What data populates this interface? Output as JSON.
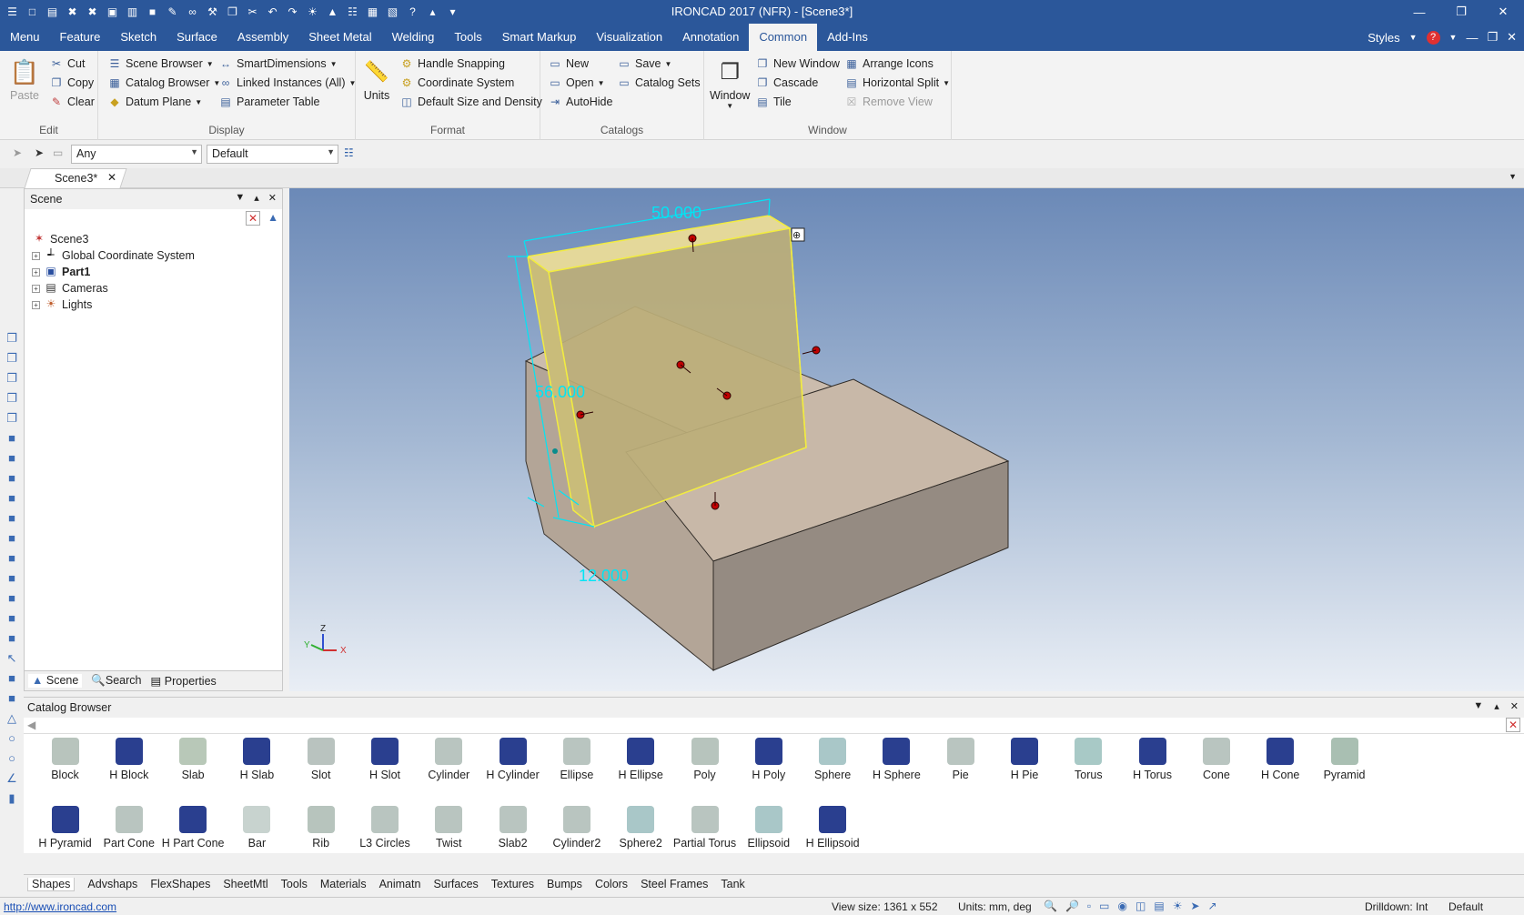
{
  "window": {
    "title": "IRONCAD 2017 (NFR) - [Scene3*]"
  },
  "qat_icons": [
    "app-menu-icon",
    "new-icon",
    "open-icon",
    "close-icon",
    "close-all-icon",
    "print-preview-icon",
    "open-folder-icon",
    "save-icon",
    "edit-icon",
    "link-icon",
    "tool-icon",
    "copy-icon",
    "cut-icon",
    "undo-icon",
    "redo-icon",
    "lightbulb-icon",
    "smart-icon",
    "list-icon",
    "table-icon",
    "layout-icon",
    "help-icon",
    "graduation-icon",
    "more-icon"
  ],
  "ribbon_tabs": [
    {
      "label": "Menu"
    },
    {
      "label": "Feature"
    },
    {
      "label": "Sketch"
    },
    {
      "label": "Surface"
    },
    {
      "label": "Assembly"
    },
    {
      "label": "Sheet Metal"
    },
    {
      "label": "Welding"
    },
    {
      "label": "Tools"
    },
    {
      "label": "Smart Markup"
    },
    {
      "label": "Visualization"
    },
    {
      "label": "Annotation"
    },
    {
      "label": "Common",
      "active": true
    },
    {
      "label": "Add-Ins"
    }
  ],
  "styles_label": "Styles",
  "ribbon": {
    "edit": {
      "label": "Edit",
      "paste": "Paste",
      "cut": "Cut",
      "copy": "Copy",
      "clear": "Clear"
    },
    "display": {
      "label": "Display",
      "scene_browser": "Scene Browser",
      "catalog_browser": "Catalog Browser",
      "datum_plane": "Datum Plane",
      "smart_dimensions": "SmartDimensions",
      "linked_instances": "Linked Instances (All)",
      "parameter_table": "Parameter Table"
    },
    "format": {
      "label": "Format",
      "units": "Units",
      "handle_snapping": "Handle Snapping",
      "coordinate_system": "Coordinate System",
      "default_size": "Default Size and Density"
    },
    "catalogs": {
      "label": "Catalogs",
      "new": "New",
      "open": "Open",
      "autohide": "AutoHide",
      "save": "Save",
      "catalog_sets": "Catalog Sets"
    },
    "window": {
      "label": "Window",
      "window": "Window",
      "new_window": "New Window",
      "cascade": "Cascade",
      "tile": "Tile",
      "arrange_icons": "Arrange Icons",
      "horizontal_split": "Horizontal Split",
      "remove_view": "Remove View"
    }
  },
  "selection": {
    "filter": "Any",
    "style": "Default"
  },
  "doc_tab": "Scene3*",
  "scene_panel": {
    "title": "Scene",
    "tree": [
      {
        "label": "Scene3",
        "icon": "scene-icon",
        "bold": false
      },
      {
        "label": "Global Coordinate System",
        "icon": "coordinate-icon",
        "bold": false
      },
      {
        "label": "Part1",
        "icon": "part-icon",
        "bold": true
      },
      {
        "label": "Cameras",
        "icon": "camera-icon",
        "bold": false
      },
      {
        "label": "Lights",
        "icon": "light-icon",
        "bold": false
      }
    ],
    "tabs": [
      "Scene",
      "Search",
      "Properties"
    ]
  },
  "dimensions": {
    "width": "50.000",
    "height": "56.000",
    "depth": "12.000"
  },
  "triad": {
    "x": "X",
    "y": "Y",
    "z": "Z"
  },
  "catalog": {
    "title": "Catalog Browser",
    "items": [
      {
        "label": "Block",
        "color": "#b8c4bd"
      },
      {
        "label": "H Block",
        "color": "#2a3f8f"
      },
      {
        "label": "Slab",
        "color": "#b8c8b8"
      },
      {
        "label": "H Slab",
        "color": "#2a3f8f"
      },
      {
        "label": "Slot",
        "color": "#b9c3bf"
      },
      {
        "label": "H Slot",
        "color": "#2a3f8f"
      },
      {
        "label": "Cylinder",
        "color": "#b9c5c0"
      },
      {
        "label": "H Cylinder",
        "color": "#2a3f8f"
      },
      {
        "label": "Ellipse",
        "color": "#b9c5c0"
      },
      {
        "label": "H Ellipse",
        "color": "#2a3f8f"
      },
      {
        "label": "Poly",
        "color": "#b7c4bd"
      },
      {
        "label": "H Poly",
        "color": "#2a3f8f"
      },
      {
        "label": "Sphere",
        "color": "#a9c7c8"
      },
      {
        "label": "H Sphere",
        "color": "#2a3f8f"
      },
      {
        "label": "Pie",
        "color": "#b9c5c0"
      },
      {
        "label": "H Pie",
        "color": "#2a3f8f"
      },
      {
        "label": "Torus",
        "color": "#a8c9c6"
      },
      {
        "label": "H Torus",
        "color": "#2a3f8f"
      },
      {
        "label": "Cone",
        "color": "#b9c5c0"
      },
      {
        "label": "H Cone",
        "color": "#2a3f8f"
      },
      {
        "label": "Pyramid",
        "color": "#a9bfb2"
      },
      {
        "label": "H Pyramid",
        "color": "#2a3f8f"
      },
      {
        "label": "Part Cone",
        "color": "#b9c5c0"
      },
      {
        "label": "H Part Cone",
        "color": "#2a3f8f"
      },
      {
        "label": "Bar",
        "color": "#c8d3cf"
      },
      {
        "label": "Rib",
        "color": "#b7c4bd"
      },
      {
        "label": "L3 Circles",
        "color": "#b9c5c0"
      },
      {
        "label": "Twist",
        "color": "#b9c5c0"
      },
      {
        "label": "Slab2",
        "color": "#b9c5c0"
      },
      {
        "label": "Cylinder2",
        "color": "#b9c5c0"
      },
      {
        "label": "Sphere2",
        "color": "#a9c7c8"
      },
      {
        "label": "Partial Torus",
        "color": "#b9c5c0"
      },
      {
        "label": "Ellipsoid",
        "color": "#a9c7c8"
      },
      {
        "label": "H Ellipsoid",
        "color": "#2a3f8f"
      }
    ],
    "tabs": [
      "Shapes",
      "Advshaps",
      "FlexShapes",
      "SheetMtl",
      "Tools",
      "Materials",
      "Animatn",
      "Surfaces",
      "Textures",
      "Bumps",
      "Colors",
      "Steel Frames",
      "Tank"
    ]
  },
  "status": {
    "link": "http://www.ironcad.com",
    "view_size": "View size: 1361 x 552",
    "units": "Units: mm, deg",
    "drilldown": "Drilldown: Int",
    "default": "Default"
  }
}
